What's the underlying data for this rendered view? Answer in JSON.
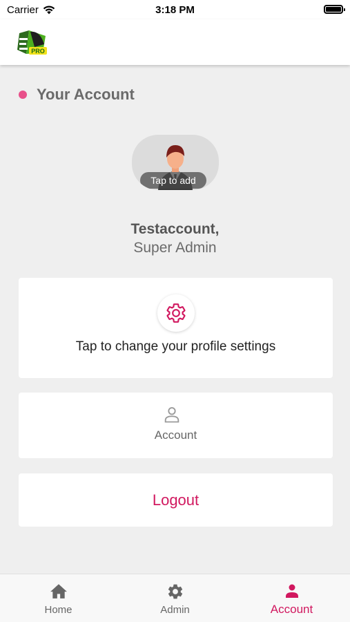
{
  "status_bar": {
    "carrier": "Carrier",
    "time": "3:18 PM"
  },
  "header": {
    "logo_icon": "app-logo-icon",
    "logo_badge": "PRO"
  },
  "section": {
    "title": "Your Account"
  },
  "profile": {
    "avatar_badge": "Tap to add",
    "name": "Testaccount,",
    "role": "Super Admin"
  },
  "cards": {
    "settings": {
      "icon": "gear-icon",
      "label": "Tap to change your profile settings"
    },
    "account": {
      "icon": "person-icon",
      "label": "Account"
    },
    "logout": {
      "label": "Logout"
    }
  },
  "tab_bar": {
    "tabs": [
      {
        "label": "Home",
        "icon": "home-icon"
      },
      {
        "label": "Admin",
        "icon": "gear-icon"
      },
      {
        "label": "Account",
        "icon": "person-icon",
        "active": true
      }
    ]
  },
  "colors": {
    "accent": "#d1185f",
    "dot": "#e8508a",
    "background": "#efefef"
  }
}
